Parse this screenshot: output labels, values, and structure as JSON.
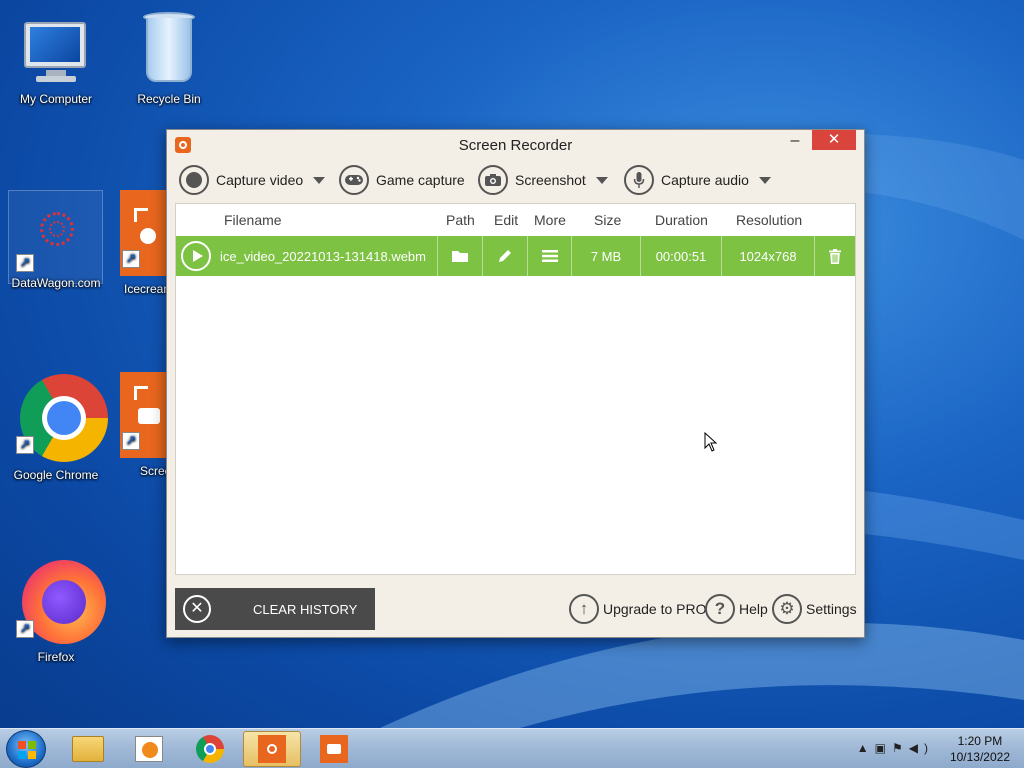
{
  "desktop": {
    "icons": [
      {
        "label": "My Computer"
      },
      {
        "label": "Recycle Bin"
      },
      {
        "label": "DataWagon.com"
      },
      {
        "label": "Icecream Rec"
      },
      {
        "label": "Google Chrome"
      },
      {
        "label": "Scree"
      },
      {
        "label": "Firefox"
      }
    ]
  },
  "window": {
    "title": "Screen Recorder",
    "minimize": "–",
    "close": "✕",
    "toolbar": {
      "capture_video": "Capture video",
      "game_capture": "Game capture",
      "screenshot": "Screenshot",
      "capture_audio": "Capture audio"
    },
    "columns": [
      "Filename",
      "Path",
      "Edit",
      "More",
      "Size",
      "Duration",
      "Resolution"
    ],
    "rows": [
      {
        "filename": "ice_video_20221013-131418.webm",
        "size": "7 MB",
        "duration": "00:00:51",
        "resolution": "1024x768"
      }
    ],
    "footer": {
      "clear_history": "CLEAR HISTORY",
      "upgrade": "Upgrade to PRO",
      "help": "Help",
      "settings": "Settings"
    }
  },
  "taskbar": {
    "time": "1:20 PM",
    "date": "10/13/2022"
  },
  "colors": {
    "accent": "#7dc242",
    "close": "#d9443c",
    "brand": "#e8661e"
  }
}
